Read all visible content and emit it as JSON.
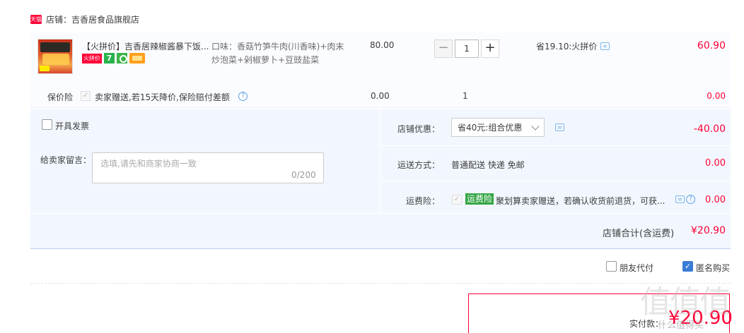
{
  "shop": {
    "badge": "天猫",
    "label": "店铺：吉香居食品旗舰店"
  },
  "item": {
    "title": "【火拼价】吉香居辣椒酱暴下饭...",
    "badges": {
      "promo": "火拼价",
      "seven": "7"
    },
    "attributes": "口味：香菇竹笋牛肉(川香味)+肉末炒泡菜+剁椒萝卜+豆豉盐菜",
    "price": "80.00",
    "quantity": "1",
    "minus": "−",
    "plus": "+",
    "discount": "省19.10:火拼价",
    "total": "60.90"
  },
  "insurance": {
    "label": "保价险",
    "check": "✓",
    "desc": "卖家赠送,若15天降价,保险赔付差额",
    "help": "?",
    "price": "0.00",
    "qty": "1",
    "total": "0.00"
  },
  "invoice": {
    "label": "开具发票"
  },
  "message": {
    "label": "给卖家留言：",
    "placeholder": "选填,请先和商家协商一致",
    "count": "0/200"
  },
  "shop_discount": {
    "label": "店铺优惠：",
    "selected": "省40元:组合优惠",
    "amount": "-40.00"
  },
  "shipping": {
    "label": "运送方式：",
    "value": "普通配送 快递 免邮",
    "amount": "0.00"
  },
  "freight_insurance": {
    "label": "运费险：",
    "check": "✓",
    "badge": "运费险",
    "desc": "聚划算卖家赠送，若确认收货前退货，可获...",
    "help": "?",
    "amount": "0.00"
  },
  "shop_total": {
    "label": "店铺合计(含运费)",
    "amount": "¥20.90"
  },
  "options": {
    "friend_pay": "朋友代付",
    "anonymous": "匿名购买",
    "anon_check": "✓"
  },
  "payment": {
    "label": "实付款：",
    "amount": "¥20.90"
  },
  "watermark": {
    "text": "值值值",
    "url": "什么值得买"
  }
}
